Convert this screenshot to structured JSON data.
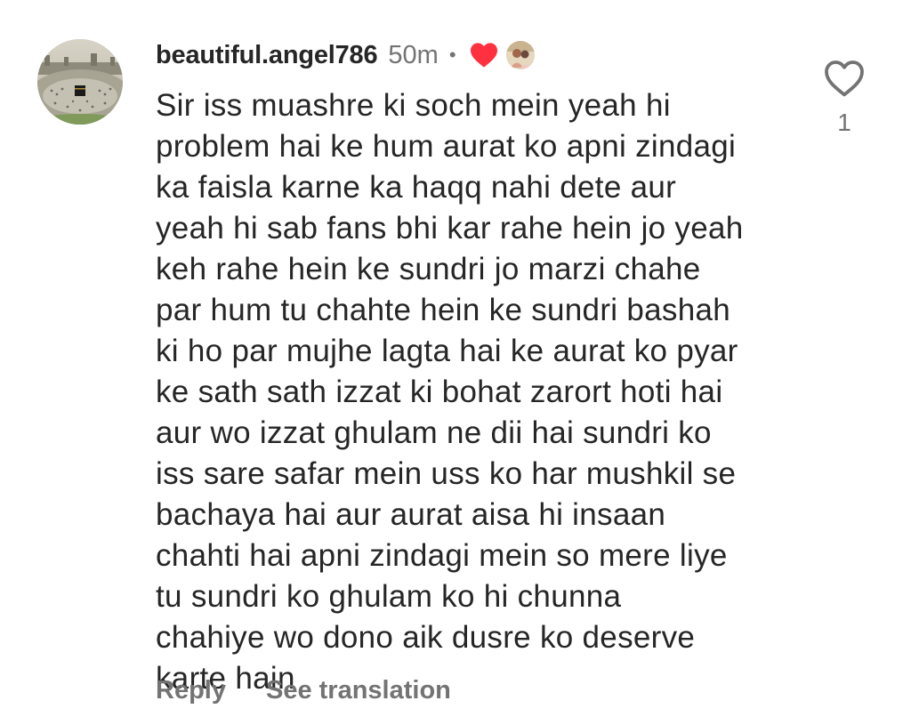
{
  "comment": {
    "username": "beautiful.angel786",
    "time": "50m",
    "separator": "•",
    "creator_liked_icon": "heart-filled-icon",
    "creator_avatar_icon": "creator-avatar",
    "avatar_icon": "profile-avatar-kaaba",
    "lines": [
      "Sir iss muashre ki soch mein yeah hi",
      "problem hai ke hum aurat ko apni zindagi",
      "ka faisla karne ka haqq nahi dete aur",
      "yeah hi sab fans bhi kar rahe hein jo yeah",
      "keh rahe hein ke sundri jo marzi chahe",
      "par hum tu chahte hein ke sundri bashah",
      "ki ho par mujhe lagta hai ke aurat ko pyar",
      "ke sath sath izzat ki bohat zarort hoti hai",
      "aur wo izzat ghulam ne dii hai sundri ko",
      "iss sare safar mein uss ko har mushkil se",
      "bachaya hai aur aurat aisa hi insaan",
      "chahti hai apni zindagi mein so mere liye",
      "tu sundri ko ghulam ko hi chunna",
      "chahiye wo dono aik dusre ko deserve",
      "karte hain"
    ],
    "like_count": "1",
    "like_icon": "heart-outline-icon",
    "actions": {
      "reply_label": "Reply",
      "translate_label": "See translation"
    }
  },
  "colors": {
    "text_primary": "#262626",
    "text_secondary": "#737373",
    "heart_red": "#ff3040"
  }
}
